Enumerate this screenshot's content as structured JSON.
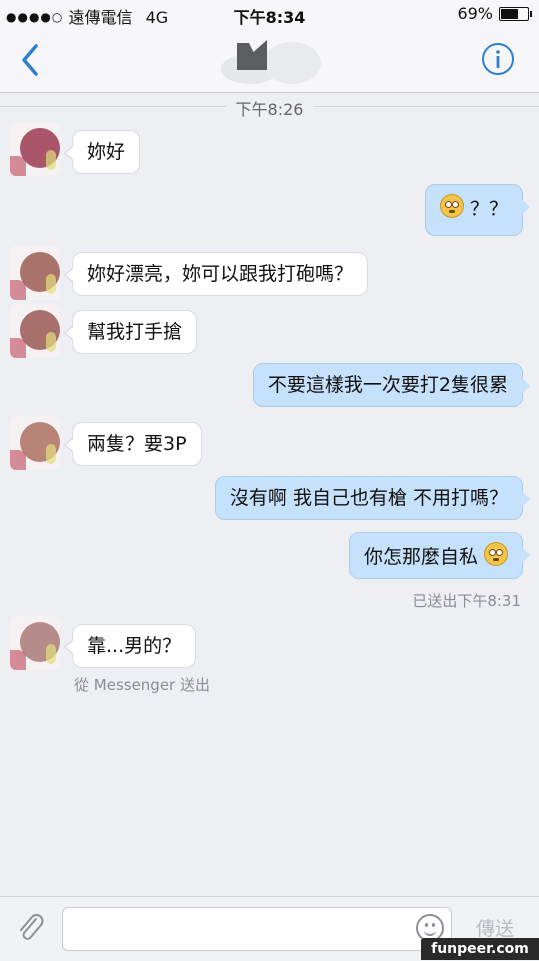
{
  "status_bar": {
    "signal": "●●●●○",
    "carrier": "遠傳電信",
    "network": "4G",
    "time": "下午8:34",
    "battery_percent": "69%",
    "battery_level": 0.69
  },
  "nav": {
    "back_icon": "chevron-left-icon",
    "info_icon": "info-icon",
    "accent_color": "#2f7fd0"
  },
  "timestamp": "下午8:26",
  "messages": [
    {
      "dir": "in",
      "text": "妳好"
    },
    {
      "dir": "out",
      "text": "？？",
      "emoji": "flushed-face-emoji"
    },
    {
      "dir": "in",
      "text": "妳好漂亮，妳可以跟我打砲嗎？"
    },
    {
      "dir": "in",
      "text": "幫我打手搶"
    },
    {
      "dir": "out",
      "text": "不要這樣我一次要打2隻很累"
    },
    {
      "dir": "in",
      "text": "兩隻？要3P"
    },
    {
      "dir": "out",
      "text": "沒有啊 我自己也有槍 不用打嗎？"
    },
    {
      "dir": "out",
      "text": "你怎那麼自私",
      "emoji": "unamused-face-emoji"
    },
    {
      "dir": "in",
      "text": "靠...男的？"
    }
  ],
  "sent_status": "已送出下午8:31",
  "sent_from": "從 Messenger 送出",
  "composer": {
    "attach_icon": "paperclip-icon",
    "emoji_icon": "smiley-icon",
    "send_label": "傳送"
  },
  "watermark": "funpeer.com"
}
